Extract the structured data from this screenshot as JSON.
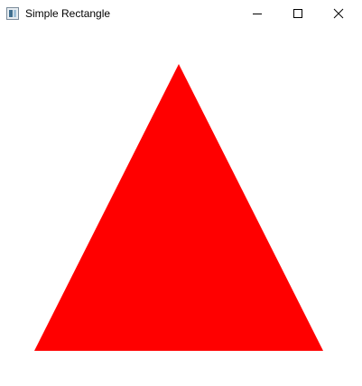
{
  "window": {
    "title": "Simple Rectangle"
  },
  "titlebar": {
    "icons": {
      "app": "app-window-icon",
      "minimize": "minimize-icon",
      "maximize": "maximize-icon",
      "close": "close-icon"
    }
  },
  "canvas": {
    "background_color": "#ffffff",
    "shape": {
      "kind": "triangle",
      "fill_color": "#ff0000"
    }
  }
}
